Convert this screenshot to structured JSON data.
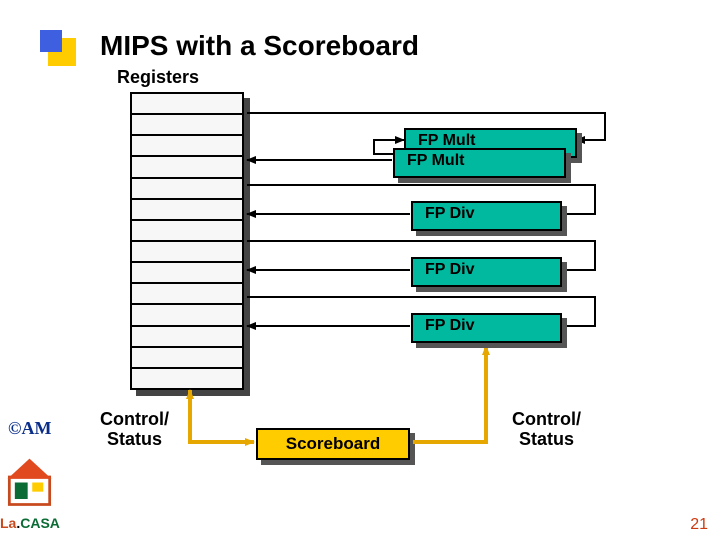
{
  "title": "MIPS with a Scoreboard",
  "labels": {
    "registers": "Registers",
    "scoreboard": "Scoreboard",
    "control_status_left": "Control/\nStatus",
    "control_status_right": "Control/\nStatus"
  },
  "functional_units": {
    "fp_mult_back": "FP Mult",
    "fp_mult_front": "FP Mult",
    "fp_div_1": "FP Div",
    "fp_div_2": "FP Div",
    "fp_div_3": "FP Div"
  },
  "register_file_rows": 14,
  "badges": {
    "am": "©AM",
    "lacasa_prefix": "La",
    "lacasa_suffix": "CASA"
  },
  "page_number": "21"
}
